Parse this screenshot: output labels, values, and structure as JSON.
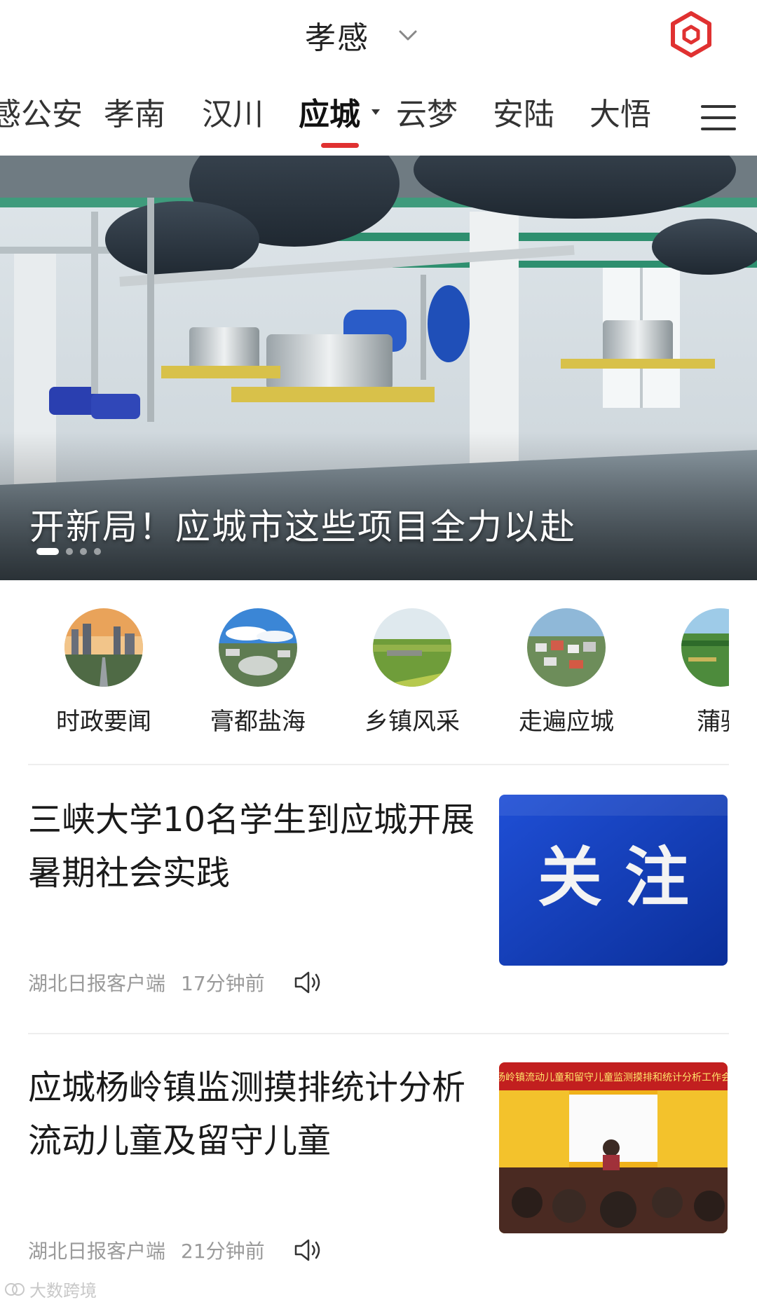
{
  "header": {
    "city": "孝感",
    "chevron_icon": "chevron-down-icon",
    "logo_icon": "hexagon-logo-icon",
    "accent_color": "#e03131"
  },
  "tabs": [
    {
      "label": "感公安",
      "active": false
    },
    {
      "label": "孝南",
      "active": false
    },
    {
      "label": "汉川",
      "active": false
    },
    {
      "label": "应城",
      "active": true
    },
    {
      "label": "云梦",
      "active": false
    },
    {
      "label": "安陆",
      "active": false
    },
    {
      "label": "大悟",
      "active": false
    }
  ],
  "menu_icon": "menu-icon",
  "banner": {
    "title": "开新局！应城市这些项目全力以赴",
    "slide_count": 4,
    "active_slide": 1
  },
  "categories": [
    {
      "label": "时政要闻",
      "icon": "city-sunset-thumb"
    },
    {
      "label": "膏都盐海",
      "icon": "plaza-thumb"
    },
    {
      "label": "乡镇风采",
      "icon": "farmland-thumb"
    },
    {
      "label": "走遍应城",
      "icon": "village-thumb"
    },
    {
      "label": "蒲骚",
      "icon": "field-thumb"
    }
  ],
  "news": [
    {
      "title": "三峡大学10名学生到应城开展暑期社会实践",
      "thumb_text": "关 注",
      "source": "湖北日报客户端",
      "time": "17分钟前"
    },
    {
      "title": "应城杨岭镇监测摸排统计分析流动儿童及留守儿童",
      "thumb_text": "杨岭镇流动儿童和留守儿童监测摸排和统计分析工作会",
      "source": "湖北日报客户端",
      "time": "21分钟前"
    }
  ],
  "watermark": "大数跨境"
}
